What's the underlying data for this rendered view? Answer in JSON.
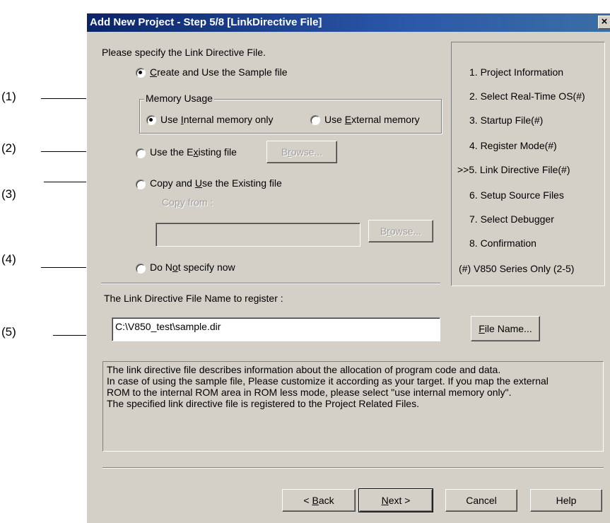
{
  "annotations": [
    "(1)",
    "(2)",
    "(3)",
    "(4)",
    "(5)"
  ],
  "window": {
    "title": "Add New Project - Step 5/8 [LinkDirective File]",
    "close_glyph": "×"
  },
  "prompt": "Please specify the Link Directive File.",
  "options": {
    "sample": {
      "label_pre": "",
      "hot": "C",
      "label_post": "reate and Use the Sample file",
      "checked": true
    },
    "existing": {
      "label_pre": "Use the E",
      "hot": "x",
      "label_post": "isting file"
    },
    "copy": {
      "label_pre": "Copy and ",
      "hot": "U",
      "label_post": "se the Existing file"
    },
    "none": {
      "label_pre": "Do N",
      "hot": "o",
      "label_post": "t specify now"
    }
  },
  "memory_usage": {
    "legend": "Memory Usage",
    "internal": {
      "label_pre": "Use ",
      "hot": "I",
      "label_post": "nternal memory only",
      "checked": true
    },
    "external": {
      "label_pre": "Use ",
      "hot": "E",
      "label_post": "xternal memory"
    }
  },
  "browse1": {
    "pre": "B",
    "hot": "r",
    "post": "owse..."
  },
  "copy_from": {
    "pre": "Co",
    "hot": "p",
    "post": "y from :",
    "value": ""
  },
  "browse2": {
    "pre": "B",
    "hot": "r",
    "post": "owse..."
  },
  "register_label": "The Link Directive File Name to register :",
  "register_value": "C:\\V850_test\\sample.dir",
  "filename_button": {
    "hot": "F",
    "post": "ile Name..."
  },
  "steps": [
    "1. Project Information",
    "2. Select Real-Time OS(#)",
    "3. Startup File(#)",
    "4. Register Mode(#)",
    ">>5. Link Directive File(#)",
    "6. Setup Source Files",
    "7. Select Debugger",
    "8. Confirmation",
    "(#) V850 Series Only (2-5)"
  ],
  "description": [
    "The link directive file describes information about the allocation of program code and data.",
    "In case of using the sample file, Please customize it according as your target. If you map the external",
    "ROM to the internal ROM area in ROM less mode, please select \"use internal memory only\".",
    "The specified link directive file is registered to the Project Related Files."
  ],
  "buttons": {
    "back": {
      "pre": "< ",
      "hot": "B",
      "post": "ack"
    },
    "next": {
      "pre": "",
      "hot": "N",
      "post": "ext >"
    },
    "cancel": "Cancel",
    "help": "Help"
  }
}
